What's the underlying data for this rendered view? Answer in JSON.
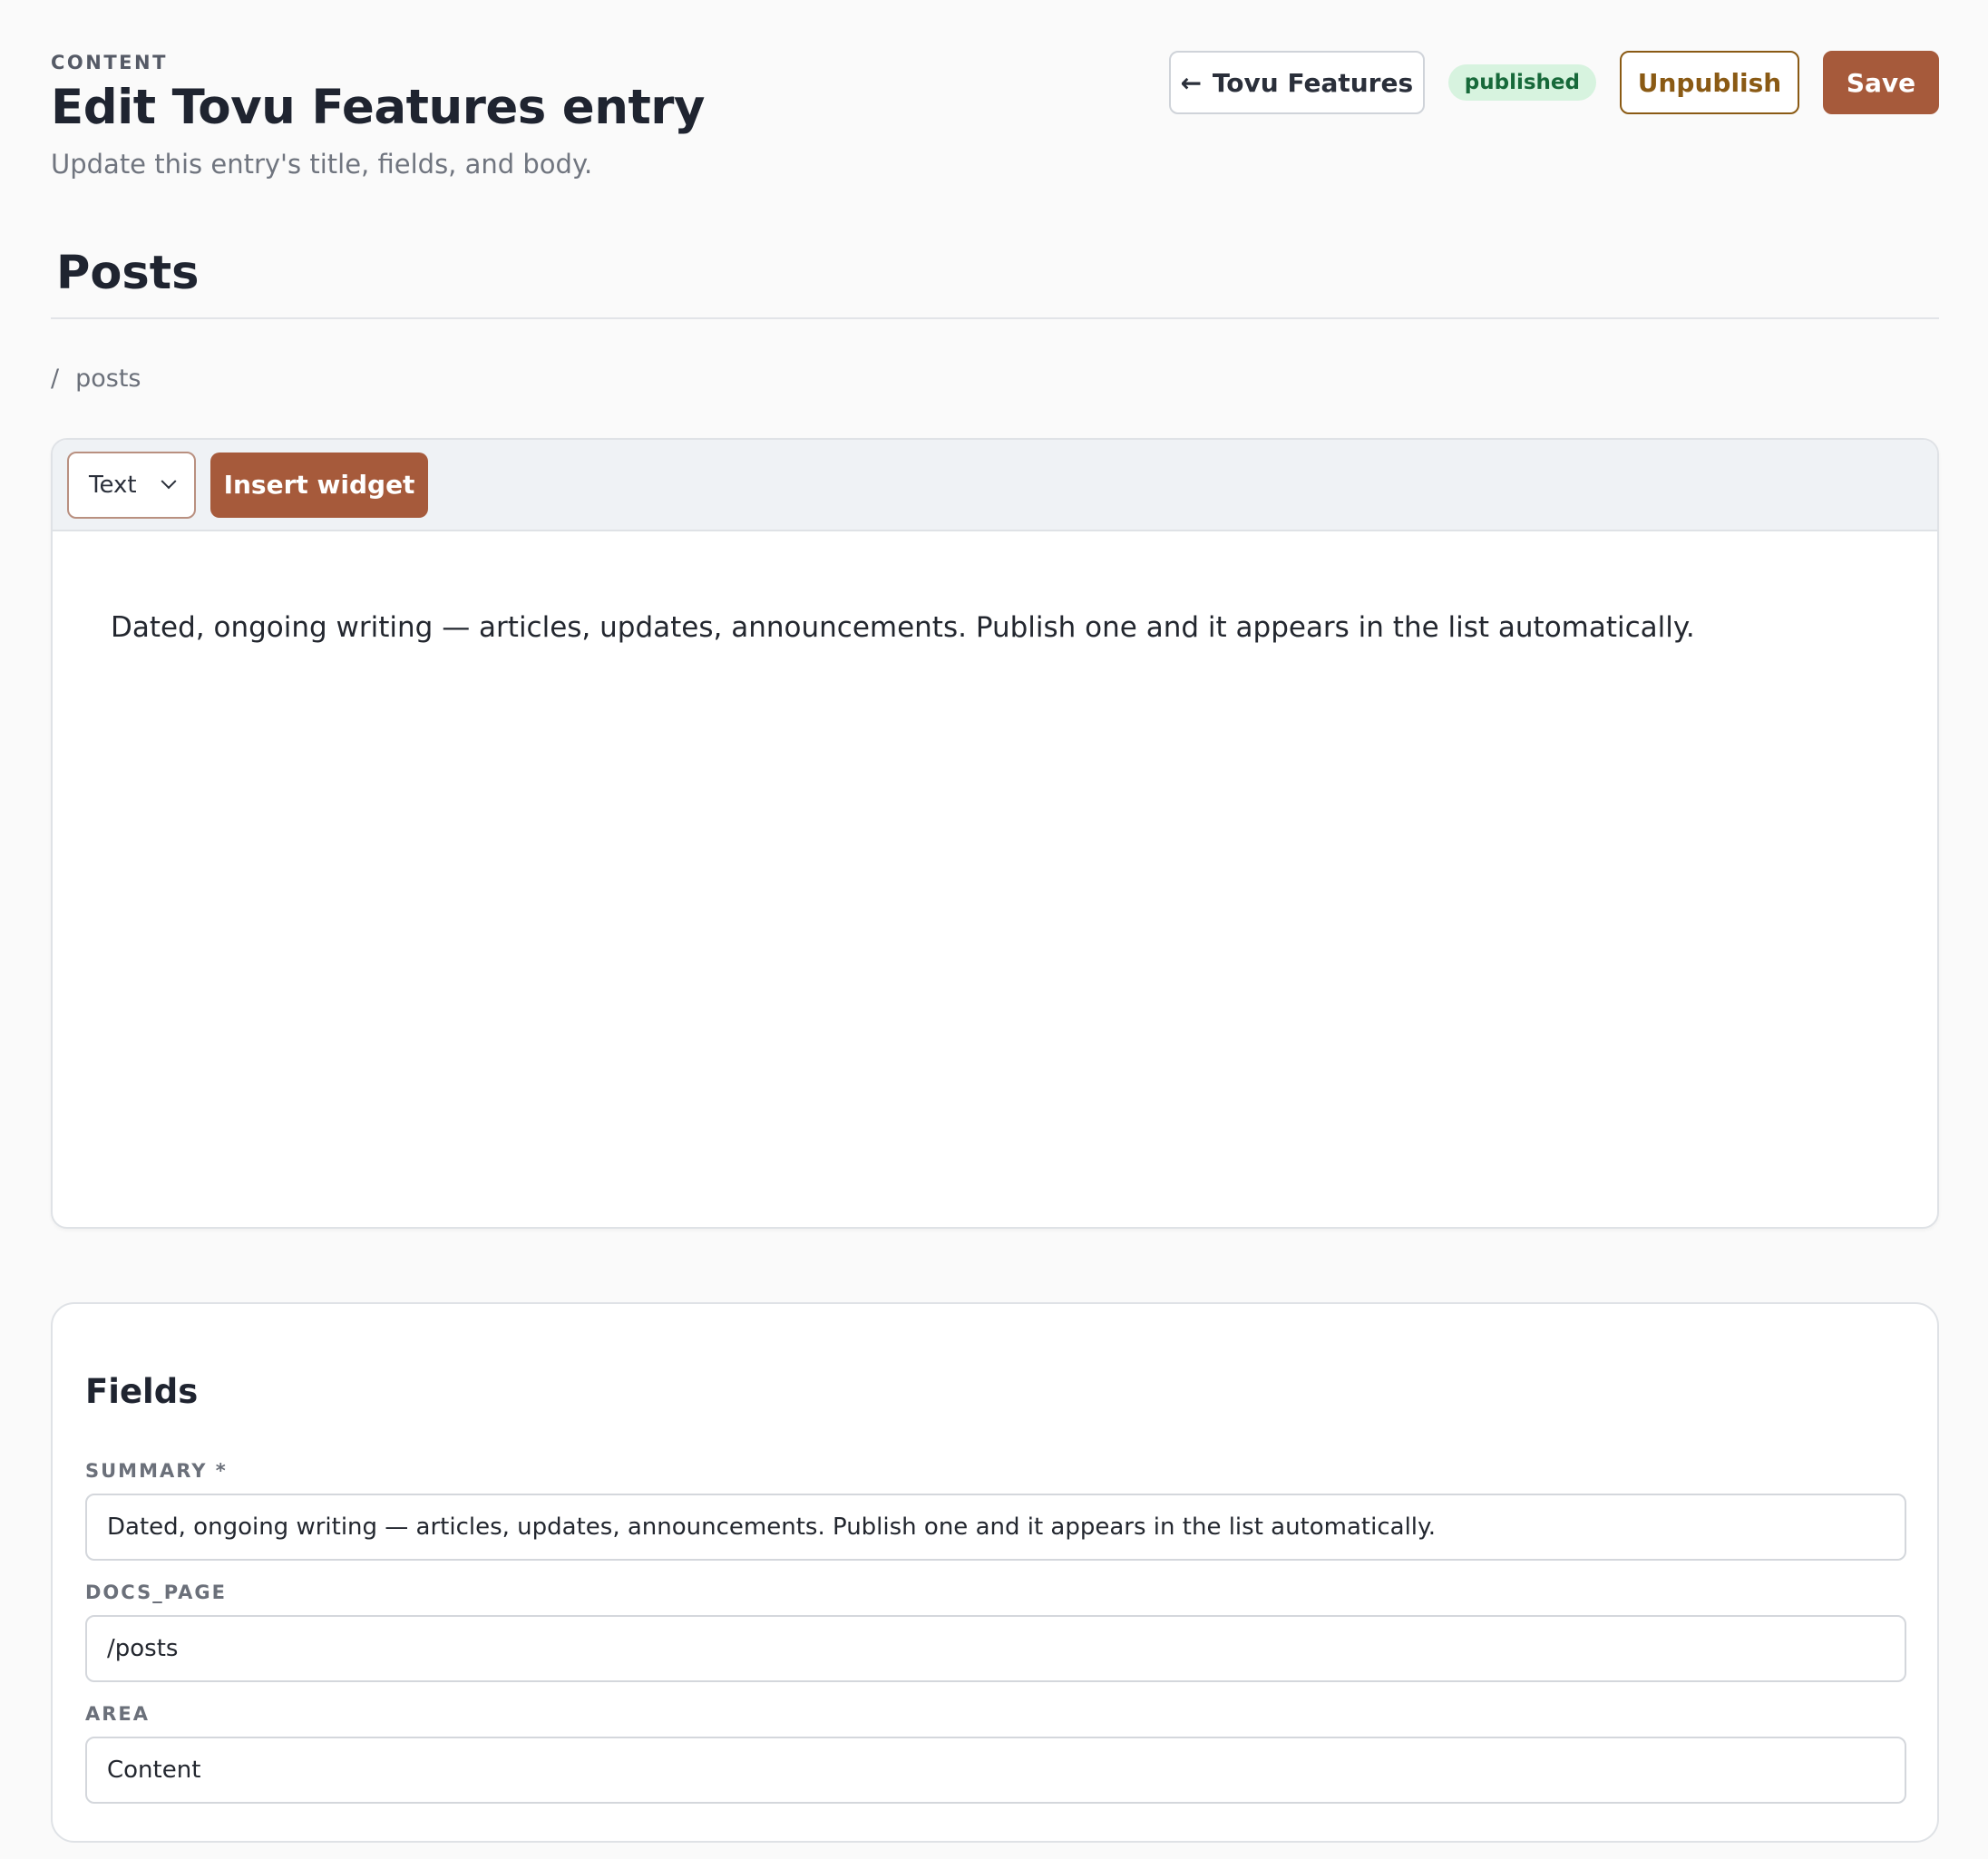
{
  "header": {
    "eyebrow": "CONTENT",
    "title": "Edit Tovu Features entry",
    "subtitle": "Update this entry's title, fields, and body.",
    "back_label": "Tovu Features",
    "status_badge": "published",
    "unpublish_label": "Unpublish",
    "save_label": "Save"
  },
  "section": {
    "title": "Posts",
    "breadcrumb_sep": "/",
    "breadcrumb_path": "posts"
  },
  "editor": {
    "block_type": "Text",
    "insert_widget_label": "Insert widget",
    "body_text": "Dated, ongoing writing — articles, updates, announcements. Publish one and it appears in the list automatically."
  },
  "fields": {
    "title": "Fields",
    "summary": {
      "label": "SUMMARY *",
      "value": "Dated, ongoing writing — articles, updates, announcements. Publish one and it appears in the list automatically."
    },
    "docs_page": {
      "label": "DOCS_PAGE",
      "value": "/posts"
    },
    "area": {
      "label": "AREA",
      "value": "Content"
    }
  },
  "icons": {
    "back": "arrow-left-icon",
    "dropdown": "chevron-down-icon"
  },
  "colors": {
    "primary": "#a65a3b",
    "unpublish": "#8a5a14",
    "badge_bg": "#d7f3df",
    "badge_text": "#17693a"
  }
}
